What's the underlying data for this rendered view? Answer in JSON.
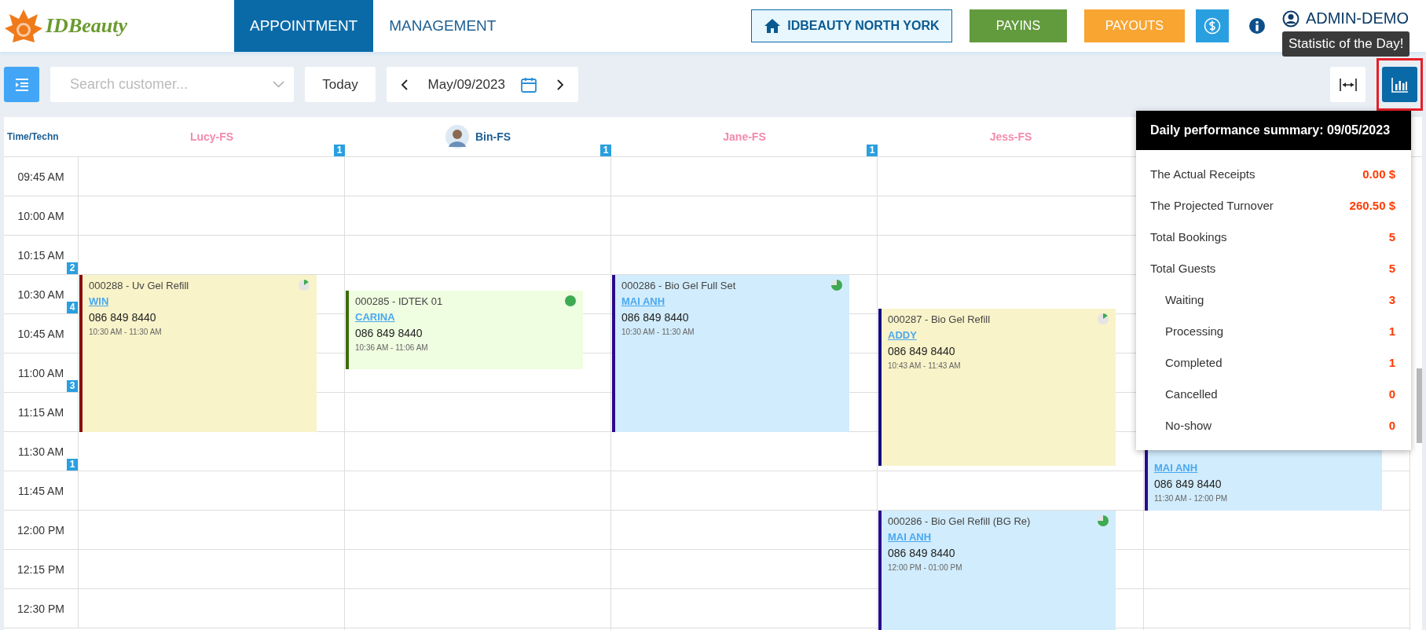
{
  "logo": {
    "text": "IDBeauty"
  },
  "nav_tabs": [
    {
      "label": "APPOINTMENT",
      "selected": true
    },
    {
      "label": "MANAGEMENT",
      "selected": false
    }
  ],
  "header_actions": [
    {
      "kind": "store",
      "label": "IDBEAUTY NORTH YORK"
    },
    {
      "kind": "payins",
      "label": "PAYINS"
    },
    {
      "kind": "payouts",
      "label": "PAYOUTS"
    }
  ],
  "user": {
    "name": "ADMIN-DEMO"
  },
  "tooltip": "Statistic of the Day!",
  "toolbar": {
    "search": {
      "placeholder": "Search customer..."
    },
    "today": "Today",
    "date": "May/09/2023"
  },
  "calendar": {
    "corner": "Time/Techn",
    "times": [
      {
        "label": "09:45 AM"
      },
      {
        "label": "10:00 AM"
      },
      {
        "label": "10:15 AM",
        "count": "2"
      },
      {
        "label": "10:30 AM",
        "count": "4"
      },
      {
        "label": "10:45 AM"
      },
      {
        "label": "11:00 AM",
        "count": "3"
      },
      {
        "label": "11:15 AM"
      },
      {
        "label": "11:30 AM",
        "count": "1"
      },
      {
        "label": "11:45 AM"
      },
      {
        "label": "12:00 PM"
      },
      {
        "label": "12:15 PM"
      },
      {
        "label": "12:30 PM"
      }
    ],
    "technicians": [
      {
        "name": "Lucy-FS",
        "color": "#f28bab",
        "avatar": false,
        "count": "1",
        "appointments": [
          {
            "title": "000288 - Uv Gel Refill",
            "customer": "WIN",
            "phone": "086 849 8440",
            "time": "10:30 AM - 11:30 AM",
            "kind": "waiting",
            "color": "#8b0d12"
          }
        ]
      },
      {
        "name": "Bin-FS",
        "color": "#1d5f95",
        "avatar": true,
        "count": "1",
        "appointments": [
          {
            "title": "000285 - IDTEK 01",
            "customer": "CARINA",
            "phone": "086 849 8440",
            "time": "10:36 AM - 11:06 AM",
            "kind": "completed",
            "color": "#3d6b0a"
          }
        ]
      },
      {
        "name": "Jane-FS",
        "color": "#f28bab",
        "avatar": false,
        "count": "1",
        "appointments": [
          {
            "title": "000286 - Bio Gel Full Set",
            "customer": "MAI ANH",
            "phone": "086 849 8440",
            "time": "10:30 AM - 11:30 AM",
            "kind": "processing",
            "color": "#2a0a8c"
          }
        ]
      },
      {
        "name": "Jess-FS",
        "color": "#f28bab",
        "avatar": false,
        "appointments": [
          {
            "title": "000287 - Bio Gel Refill",
            "customer": "ADDY",
            "phone": "086 849 8440",
            "time": "10:43 AM - 11:43 AM",
            "kind": "waiting",
            "color": "#140a80"
          },
          {
            "title": "000286 - Bio Gel Refill (BG Re)",
            "customer": "MAI ANH",
            "phone": "086 849 8440",
            "time": "12:00 PM - 01:00 PM",
            "kind": "processing",
            "color": "#2a0a8c"
          }
        ]
      },
      {
        "appointments": [
          {
            "customer": "MAI ANH",
            "phone": "086 849 8440",
            "time": "11:30 AM - 12:00 PM",
            "kind": "processing",
            "color": "#2a0a8c"
          }
        ]
      }
    ]
  },
  "stats": {
    "title": "Daily performance summary: 09/05/2023",
    "rows": [
      {
        "label": "The Actual Receipts",
        "value": "0.00 $"
      },
      {
        "label": "The Projected Turnover",
        "value": "260.50 $"
      },
      {
        "label": "Total Bookings",
        "value": "5"
      },
      {
        "label": "Total Guests",
        "value": "5",
        "children": [
          {
            "label": "Waiting",
            "value": "3"
          },
          {
            "label": "Processing",
            "value": "1"
          },
          {
            "label": "Completed",
            "value": "1"
          },
          {
            "label": "Cancelled",
            "value": "0"
          },
          {
            "label": "No-show",
            "value": "0"
          }
        ]
      }
    ]
  }
}
